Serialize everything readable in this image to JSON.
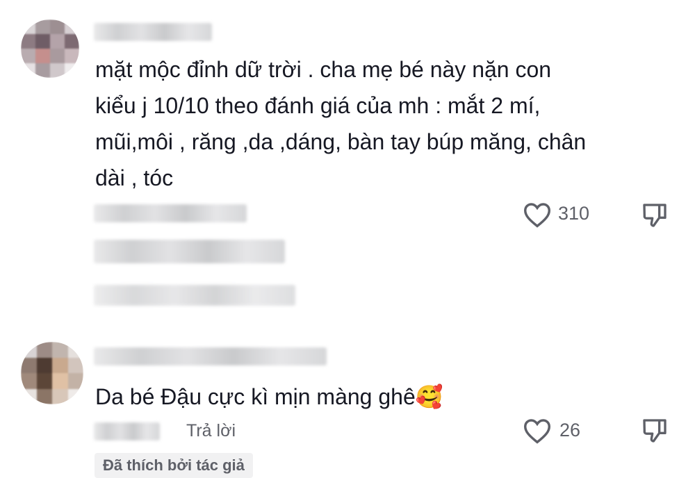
{
  "comments": [
    {
      "text": "mặt mộc đỉnh dữ trời . cha mẹ bé này nặn con kiểu j 10/10 theo đánh giá của mh : mắt 2 mí, mũi,môi , răng ,da ,dáng, bàn tay búp măng, chân dài , tóc",
      "lines": [
        "mặt mộc đỉnh dữ trời . cha mẹ bé này nặn con",
        "kiểu j 10/10 theo đánh giá của mh : mắt 2 mí,",
        "mũi,môi , răng ,da ,dáng, bàn tay búp măng, chân",
        "dài , tóc"
      ],
      "like_count": "310"
    },
    {
      "text": "Da bé Đậu cực kì mịn màng ghê",
      "emoji": "🥰",
      "reply_label": "Trả lời",
      "like_count": "26",
      "liked_by_author": "Đã thích bởi tác giả"
    }
  ],
  "icons": {
    "like": "heart-outline-icon",
    "dislike": "thumbs-down-icon"
  }
}
